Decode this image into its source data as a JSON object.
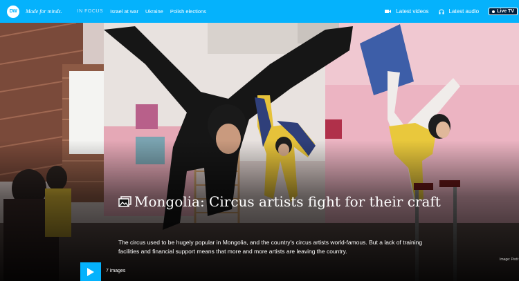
{
  "header": {
    "logo_text": "DW",
    "tagline": "Made for minds.",
    "in_focus_label": "IN FOCUS",
    "focus_links": [
      "Israel at war",
      "Ukraine",
      "Polish elections"
    ],
    "latest_videos": "Latest videos",
    "latest_audio": "Latest audio",
    "live_tv": "Live TV",
    "brand_color": "#05b2fc"
  },
  "hero": {
    "title": "Mongolia: Circus artists fight for their craft",
    "teaser": "The circus used to be hugely popular in Mongolia, and the country's circus artists world-famous. But a lack of training facilities and financial support means that more and more artists are leaving the country.",
    "image_count": "7 images",
    "credit": "Image: Pedr",
    "icons": [
      "gallery-icon",
      "play-icon",
      "video-icon",
      "headphones-icon"
    ]
  }
}
